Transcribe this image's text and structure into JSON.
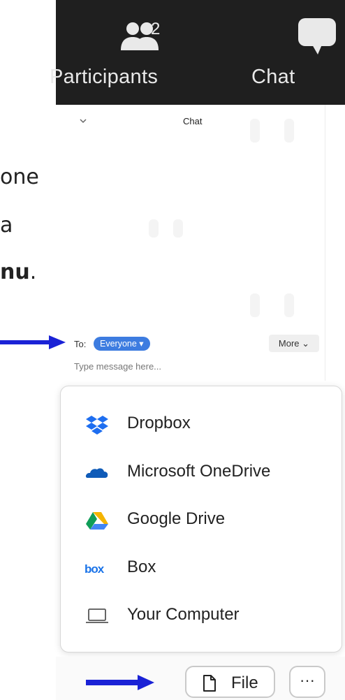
{
  "toolbar": {
    "participants_label": "Participants",
    "participants_count": "2",
    "chat_label": "Chat"
  },
  "chat_panel": {
    "title": "Chat",
    "to_label": "To:",
    "recipient": "Everyone",
    "more_label": "More",
    "message_placeholder": "Type message here..."
  },
  "background_text": {
    "line1": "one",
    "line2": "a",
    "line3_bold": "nu",
    "line3_end": "."
  },
  "file_menu": {
    "items": [
      {
        "label": "Dropbox",
        "icon": "dropbox-icon"
      },
      {
        "label": "Microsoft OneDrive",
        "icon": "onedrive-icon"
      },
      {
        "label": "Google Drive",
        "icon": "google-drive-icon"
      },
      {
        "label": "Box",
        "icon": "box-icon"
      },
      {
        "label": "Your Computer",
        "icon": "laptop-icon"
      }
    ]
  },
  "bottom_bar": {
    "file_label": "File",
    "more_label": "···"
  },
  "colors": {
    "toolbar_bg": "#1f1f1f",
    "accent_blue": "#3d7ce0",
    "arrow_blue": "#1a22d6"
  }
}
